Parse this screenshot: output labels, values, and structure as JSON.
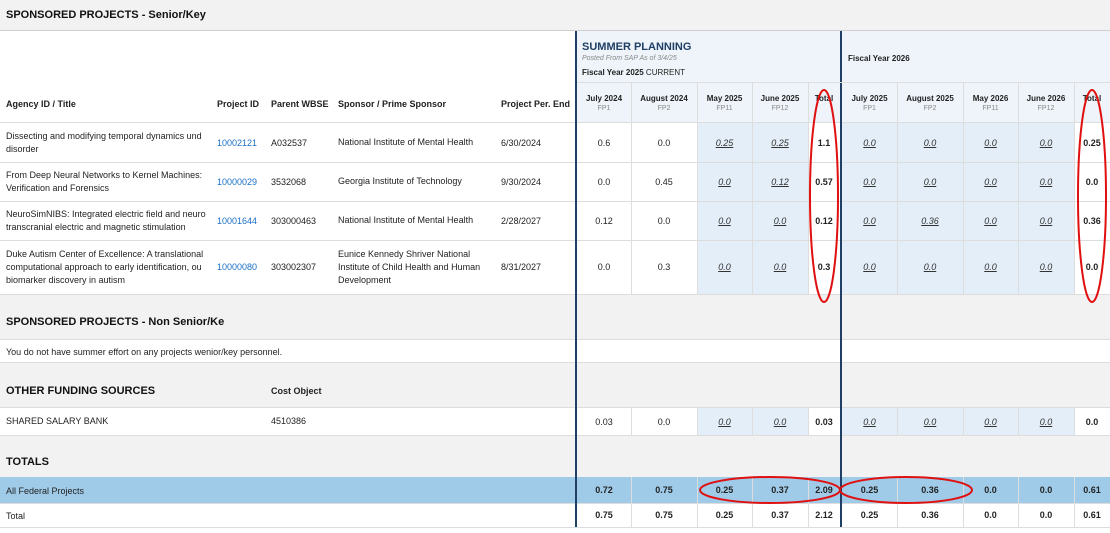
{
  "senior": {
    "title": "SPONSORED PROJECTS - Senior/Key",
    "col_agency": "Agency ID / Title",
    "col_project": "Project ID",
    "col_wbse": "Parent WBSE",
    "col_sponsor": "Sponsor / Prime Sponsor",
    "col_end": "Project Per. End",
    "rows": [
      {
        "title_l1": "Dissecting and modifying temporal dynamics und",
        "title_l2": "disorder",
        "project_id": "10002121",
        "wbse": "A032537",
        "sponsor_l1": "National Institute of Mental Health",
        "sponsor_l2": "",
        "sponsor_l3": "",
        "end": "6/30/2024",
        "v": [
          "0.6",
          "0.0",
          "0.25",
          "0.25",
          "1.1",
          "0.0",
          "0.0",
          "0.0",
          "0.0",
          "0.25"
        ]
      },
      {
        "title_l1": "From Deep Neural Networks to Kernel Machines:",
        "title_l2": "Verification and Forensics",
        "project_id": "10000029",
        "wbse": "3532068",
        "sponsor_l1": "Georgia Institute of Technology",
        "sponsor_l2": "",
        "sponsor_l3": "",
        "end": "9/30/2024",
        "v": [
          "0.0",
          "0.45",
          "0.0",
          "0.12",
          "0.57",
          "0.0",
          "0.0",
          "0.0",
          "0.0",
          "0.0"
        ]
      },
      {
        "title_l1": "NeuroSimNIBS: Integrated electric field and neuro",
        "title_l2": "transcranial electric and magnetic stimulation",
        "project_id": "10001644",
        "wbse": "303000463",
        "sponsor_l1": "National Institute of Mental Health",
        "sponsor_l2": "",
        "sponsor_l3": "",
        "end": "2/28/2027",
        "v": [
          "0.12",
          "0.0",
          "0.0",
          "0.0",
          "0.12",
          "0.0",
          "0.36",
          "0.0",
          "0.0",
          "0.36"
        ]
      },
      {
        "title_l1": "Duke Autism Center of Excellence: A translational",
        "title_l2": "computational approach to early identification, ou",
        "title_l3": "biomarker discovery in autism",
        "project_id": "10000080",
        "wbse": "303002307",
        "sponsor_l1": "Eunice Kennedy Shriver National",
        "sponsor_l2": "Institute of Child Health and Human",
        "sponsor_l3": "Development",
        "end": "8/31/2027",
        "v": [
          "0.0",
          "0.3",
          "0.0",
          "0.0",
          "0.3",
          "0.0",
          "0.0",
          "0.0",
          "0.0",
          "0.0"
        ]
      }
    ]
  },
  "summer": {
    "title": "SUMMER PLANNING",
    "posted": "Posted From SAP As of 3/4/25",
    "fy_label": "Fiscal Year 2025",
    "fy_status": "CURRENT",
    "fy26_label": "Fiscal Year 2026"
  },
  "months": [
    {
      "name": "July 2024",
      "fp": "FP1"
    },
    {
      "name": "August 2024",
      "fp": "FP2"
    },
    {
      "name": "May 2025",
      "fp": "FP11"
    },
    {
      "name": "June 2025",
      "fp": "FP12"
    },
    {
      "name": "Total",
      "fp": ""
    },
    {
      "name": "July 2025",
      "fp": "FP1"
    },
    {
      "name": "August 2025",
      "fp": "FP2"
    },
    {
      "name": "May 2026",
      "fp": "FP11"
    },
    {
      "name": "June 2026",
      "fp": "FP12"
    },
    {
      "name": "Total",
      "fp": ""
    }
  ],
  "nonsenior": {
    "title": "SPONSORED PROJECTS - Non Senior/Ke",
    "message": "You do not have summer effort on any projects wenior/key personnel."
  },
  "other": {
    "title": "OTHER FUNDING SOURCES",
    "cost_object_label": "Cost Object",
    "row_name": "SHARED SALARY BANK",
    "row_cost": "4510386",
    "v": [
      "0.03",
      "0.0",
      "0.0",
      "0.0",
      "0.03",
      "0.0",
      "0.0",
      "0.0",
      "0.0",
      "0.0"
    ]
  },
  "totals": {
    "title": "TOTALS",
    "federal_label": "All Federal Projects",
    "federal_v": [
      "0.72",
      "0.75",
      "0.25",
      "0.37",
      "2.09",
      "0.25",
      "0.36",
      "0.0",
      "0.0",
      "0.61"
    ],
    "total_label": "Total",
    "total_v": [
      "0.75",
      "0.75",
      "0.25",
      "0.37",
      "2.12",
      "0.25",
      "0.36",
      "0.0",
      "0.0",
      "0.61"
    ]
  },
  "colors": {
    "accent": "#1f3f66",
    "highlight_row": "#9fcbe8",
    "shade": "#e3eef8",
    "annotation": "#e01010",
    "link": "#1a6fc4"
  }
}
